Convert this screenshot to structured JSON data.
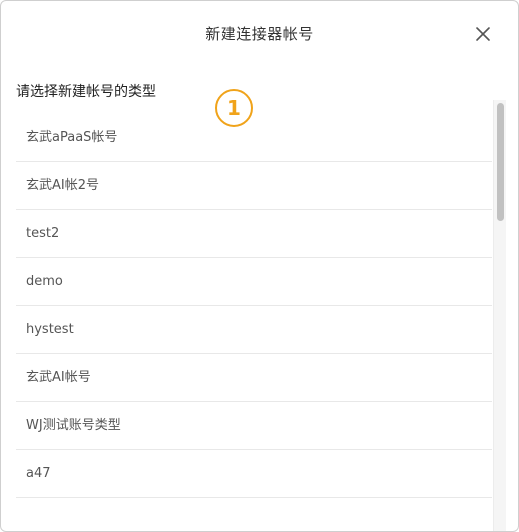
{
  "dialog": {
    "title": "新建连接器帐号",
    "close_icon": "close-icon",
    "subtitle": "请选择新建帐号的类型",
    "step_badge": "1",
    "badge_color": "#f0a31a"
  },
  "account_types": [
    {
      "label": "玄武aPaaS帐号"
    },
    {
      "label": "玄武AI帐2号"
    },
    {
      "label": "test2"
    },
    {
      "label": "demo"
    },
    {
      "label": "hystest"
    },
    {
      "label": "玄武AI帐号"
    },
    {
      "label": "WJ测试账号类型"
    },
    {
      "label": "a47"
    }
  ]
}
